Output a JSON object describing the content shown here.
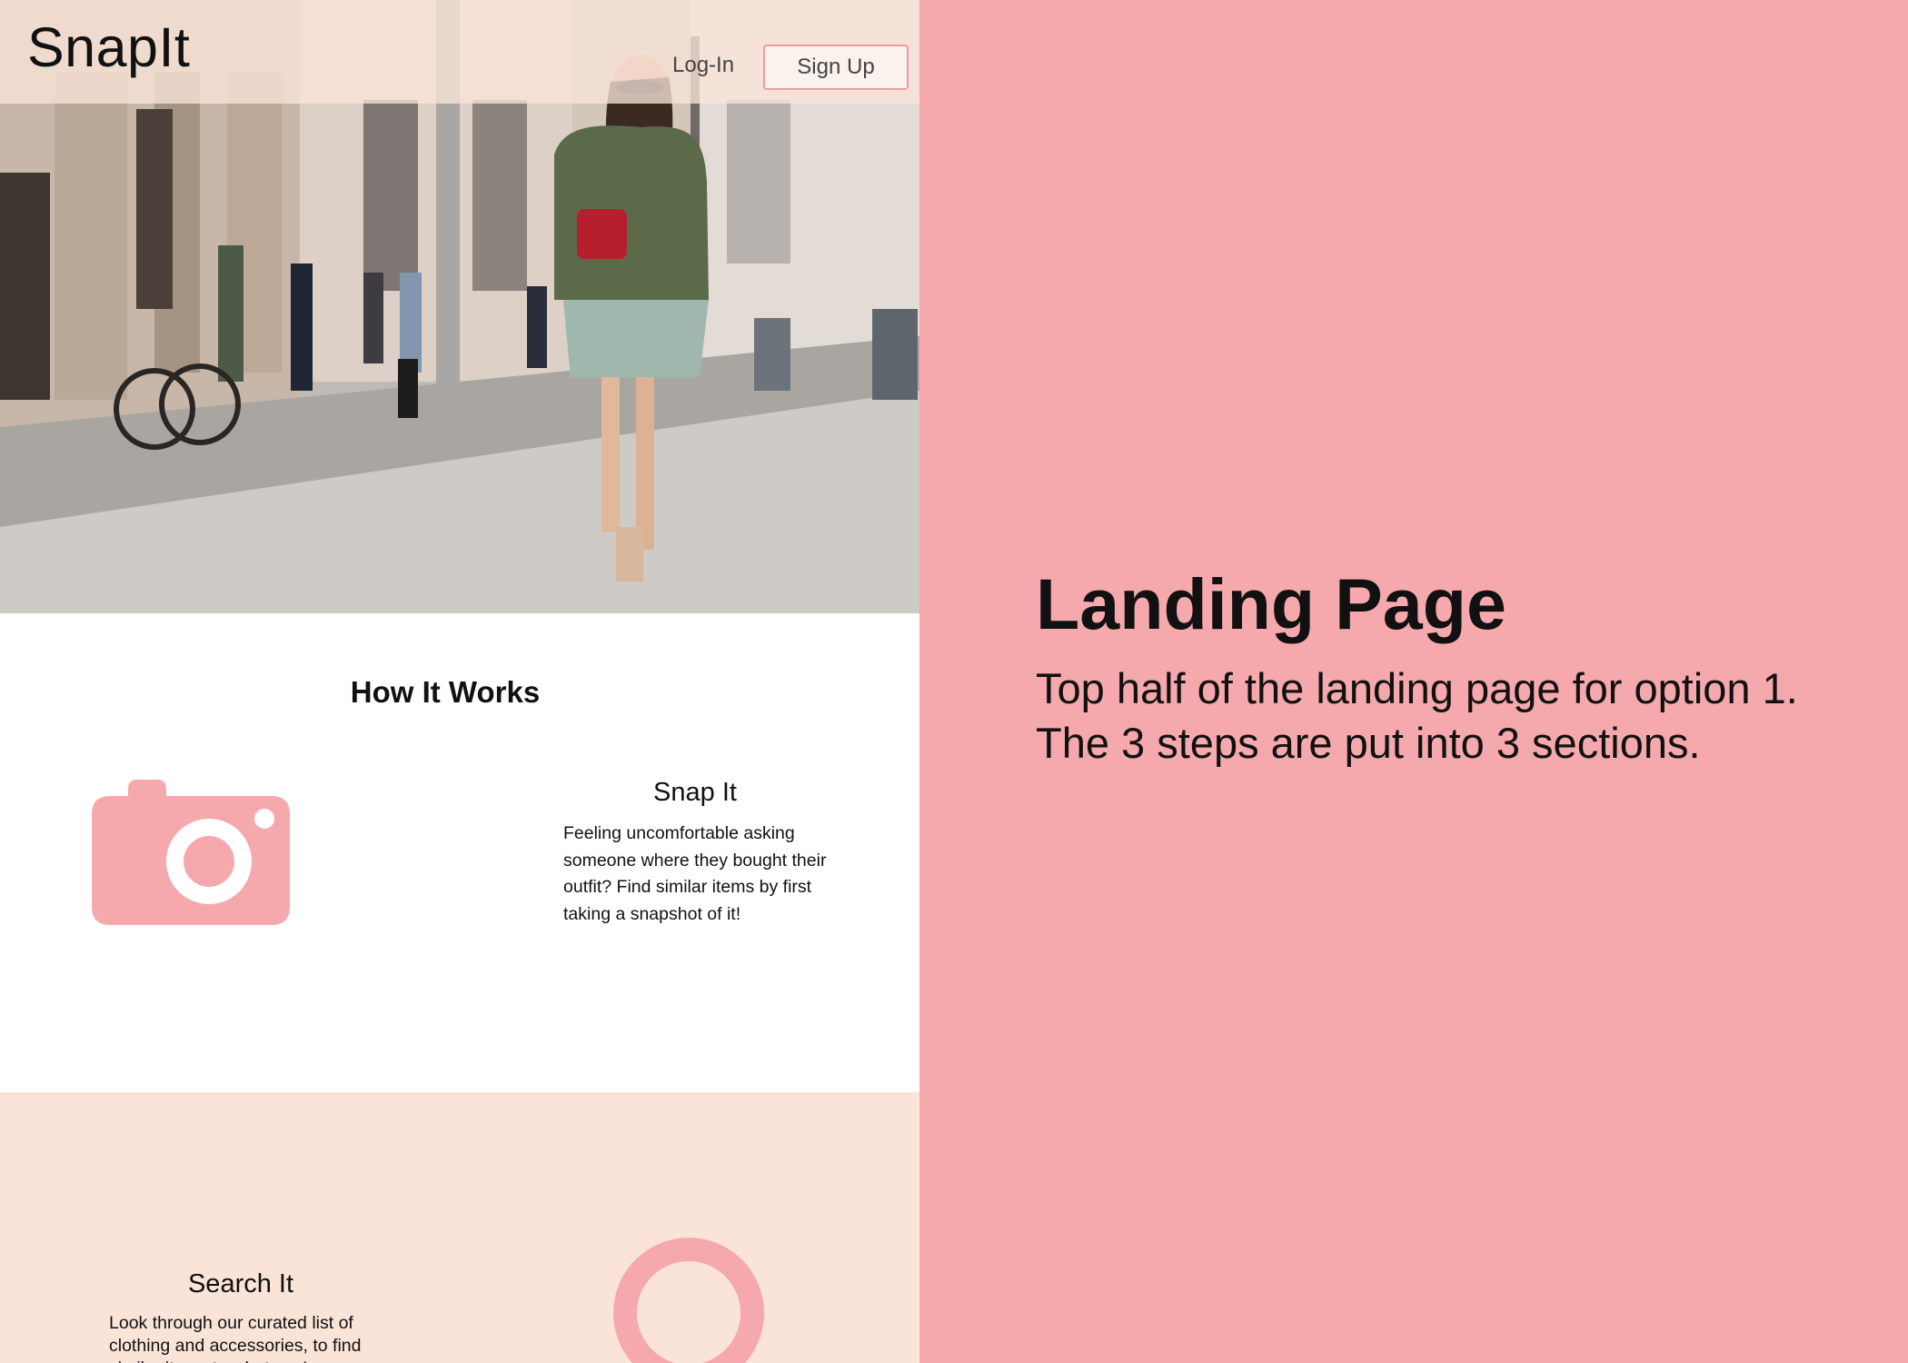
{
  "site": {
    "logo": "SnapIt",
    "nav": {
      "login_label": "Log-In",
      "signup_label": "Sign Up"
    }
  },
  "how_it_works": {
    "title": "How It Works",
    "steps": [
      {
        "title": "Snap It",
        "description": "Feeling uncomfortable asking someone where they bought their outfit? Find similar items by first taking a snapshot of it!",
        "icon": "camera-icon"
      },
      {
        "title": "Search It",
        "description": "Look through our curated list of clothing and accessories, to find similar items to what you’ve",
        "icon": "search-icon"
      }
    ]
  },
  "annotation": {
    "title": "Landing Page",
    "description": "Top half of the landing page for option 1. The 3 steps are put into 3 sections."
  },
  "colors": {
    "accent_pink": "#f6a9ad",
    "peach": "#fae4d8",
    "text": "#111111",
    "button_border": "#f19aa2"
  }
}
